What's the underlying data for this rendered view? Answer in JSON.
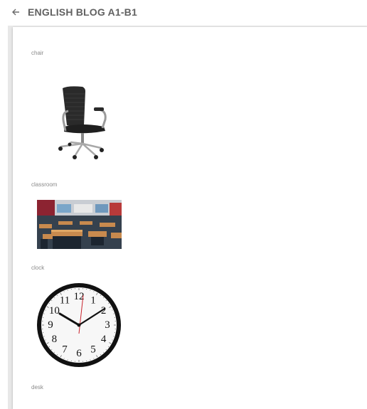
{
  "header": {
    "title": "ENGLISH BLOG A1-B1",
    "back_icon": "arrow-left-icon"
  },
  "items": [
    {
      "label": "chair",
      "image": "office-chair"
    },
    {
      "label": "classroom",
      "image": "classroom-photo"
    },
    {
      "label": "clock",
      "image": "wall-clock"
    },
    {
      "label": "desk",
      "image": ""
    }
  ],
  "clock_numerals": [
    "12",
    "1",
    "2",
    "3",
    "4",
    "5",
    "6",
    "7",
    "8",
    "9",
    "10",
    "11"
  ],
  "colors": {
    "title": "#616161",
    "label": "#8a8a8a",
    "frame": "#e8e8e8"
  }
}
